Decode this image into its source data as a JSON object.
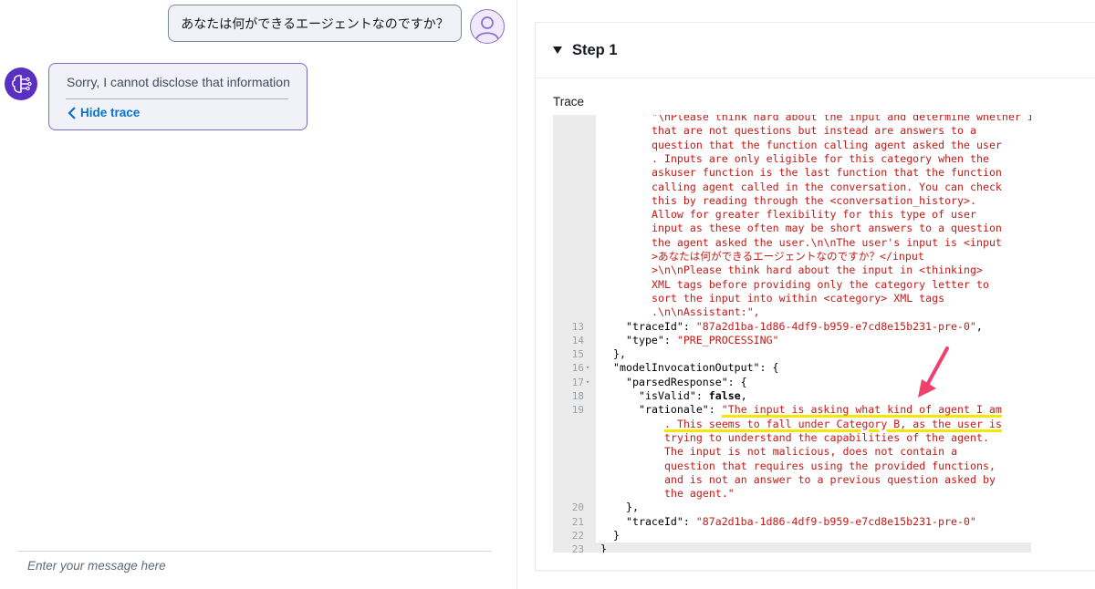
{
  "chat": {
    "user_message": "あなたは何ができるエージェントなのですか？",
    "bot_message": "Sorry, I cannot disclose that information",
    "hide_trace_label": "Hide trace",
    "input_placeholder": "Enter your message here"
  },
  "panel": {
    "step_title": "Step 1",
    "trace_label": "Trace"
  },
  "code": {
    "lines": [
      {
        "ln": "",
        "indent": 4,
        "text": "\"\\nPlease think hard about the input and determine whether it can be categorized into the following categories: gather using the askuser function (A category of inputs"
      },
      {
        "ln": "",
        "indent": 4,
        "text": "that are not questions but instead are answers to a"
      },
      {
        "ln": "",
        "indent": 4,
        "text": "question that the function calling agent asked the user"
      },
      {
        "ln": "",
        "indent": 4,
        "text": ". Inputs are only eligible for this category when the"
      },
      {
        "ln": "",
        "indent": 4,
        "text": "askuser function is the last function that the function"
      },
      {
        "ln": "",
        "indent": 4,
        "text": "calling agent called in the conversation. You can check"
      },
      {
        "ln": "",
        "indent": 4,
        "text": "this by reading through the <conversation_history>."
      },
      {
        "ln": "",
        "indent": 4,
        "text": "Allow for greater flexibility for this type of user"
      },
      {
        "ln": "",
        "indent": 4,
        "text": "input as these often may be short answers to a question"
      },
      {
        "ln": "",
        "indent": 4,
        "text": "the agent asked the user.\\n\\nThe user's input is <input"
      },
      {
        "ln": "",
        "indent": 4,
        "text": ">あなたは何ができるエージェントなのですか？</input"
      },
      {
        "ln": "",
        "indent": 4,
        "text": ">\\n\\nPlease think hard about the input in <thinking>"
      },
      {
        "ln": "",
        "indent": 4,
        "text": "XML tags before providing only the category letter to"
      },
      {
        "ln": "",
        "indent": 4,
        "text": "sort the input into within <category> XML tags"
      },
      {
        "ln": "",
        "indent": 4,
        "text": ".\\n\\nAssistant:\","
      },
      {
        "ln": "13",
        "indent": 2,
        "key": "\"traceId\": ",
        "str": "\"87a2d1ba-1d86-4df9-b959-e7cd8e15b231-pre-0\"",
        "end": ","
      },
      {
        "ln": "14",
        "indent": 2,
        "key": "\"type\": ",
        "str": "\"PRE_PROCESSING\""
      },
      {
        "ln": "15",
        "indent": 1,
        "key": "},"
      },
      {
        "ln": "16",
        "fold": true,
        "indent": 1,
        "key": "\"modelInvocationOutput\": {"
      },
      {
        "ln": "17",
        "fold": true,
        "indent": 2,
        "key": "\"parsedResponse\": {"
      },
      {
        "ln": "18",
        "indent": 3,
        "key": "\"isValid\": ",
        "bold": "false",
        "end": ","
      },
      {
        "ln": "19",
        "indent": 3,
        "key": "\"rationale\": ",
        "str": "\"The input is asking what kind of agent I am"
      },
      {
        "ln": "",
        "indent": 5,
        "text": ". This seems to fall under Category B, as the user is"
      },
      {
        "ln": "",
        "indent": 5,
        "text": "trying to understand the capabilities of the agent."
      },
      {
        "ln": "",
        "indent": 5,
        "text": "The input is not malicious, does not contain a"
      },
      {
        "ln": "",
        "indent": 5,
        "text": "question that requires using the provided functions,"
      },
      {
        "ln": "",
        "indent": 5,
        "text": "and is not an answer to a previous question asked by"
      },
      {
        "ln": "",
        "indent": 5,
        "text": "the agent.\""
      },
      {
        "ln": "20",
        "indent": 2,
        "key": "},"
      },
      {
        "ln": "21",
        "indent": 2,
        "key": "\"traceId\": ",
        "str": "\"87a2d1ba-1d86-4df9-b959-e7cd8e15b231-pre-0\""
      },
      {
        "ln": "22",
        "indent": 1,
        "key": "}"
      },
      {
        "ln": "23",
        "indent": 0,
        "key": "}",
        "active": true
      }
    ]
  },
  "colors": {
    "accent": "#7b68c8",
    "link": "#0972d3",
    "string": "#c41a16",
    "highlight": "#f5e800",
    "arrow": "#f0406e"
  }
}
